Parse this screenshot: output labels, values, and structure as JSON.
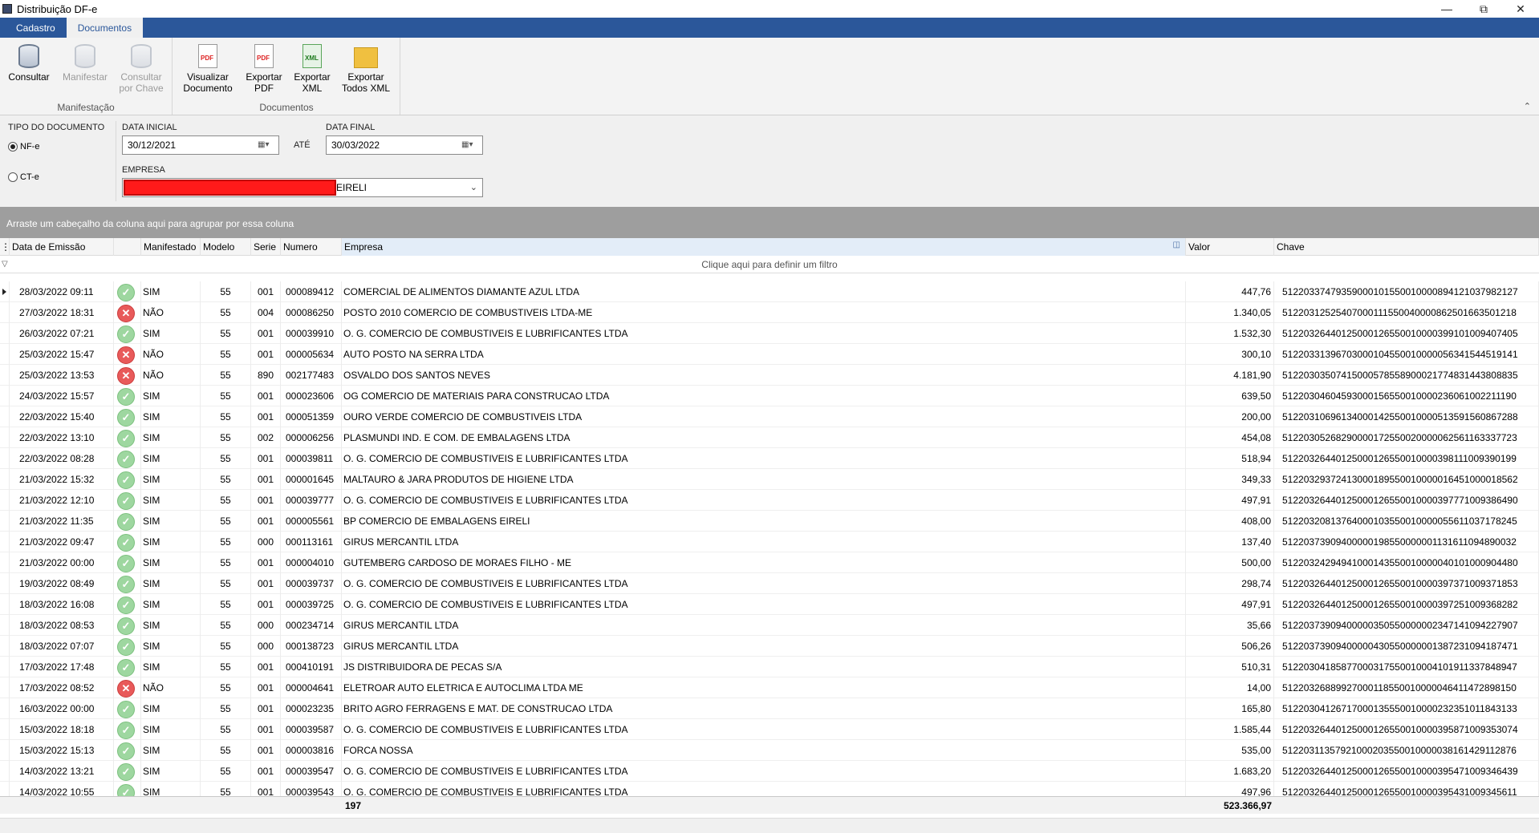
{
  "window": {
    "title": "Distribuição DF-e"
  },
  "tabs": [
    "Cadastro",
    "Documentos"
  ],
  "ribbon": {
    "groups": {
      "manifestacao": "Manifestação",
      "documentos": "Documentos"
    },
    "buttons": {
      "consultar": "Consultar",
      "manifestar": "Manifestar",
      "consultar_chave_1": "Consultar",
      "consultar_chave_2": "por Chave",
      "visualizar_1": "Visualizar",
      "visualizar_2": "Documento",
      "exp_pdf_1": "Exportar",
      "exp_pdf_2": "PDF",
      "exp_xml_1": "Exportar",
      "exp_xml_2": "XML",
      "exp_todos_1": "Exportar",
      "exp_todos_2": "Todos XML"
    }
  },
  "filters": {
    "tipo_label": "TIPO DO DOCUMENTO",
    "nfe": "NF-e",
    "cte": "CT-e",
    "data_inicial_label": "DATA INICIAL",
    "data_inicial": "30/12/2021",
    "ate": "ATÉ",
    "data_final_label": "DATA FINAL",
    "data_final": "30/03/2022",
    "empresa_label": "EMPRESA",
    "empresa_suffix": "EIRELI"
  },
  "grid": {
    "group_hint": "Arraste um cabeçalho da coluna aqui para agrupar por essa coluna",
    "filter_hint": "Clique aqui para definir um filtro",
    "columns": {
      "data": "Data de Emissão",
      "manifestado": "Manifestado",
      "modelo": "Modelo",
      "serie": "Serie",
      "numero": "Numero",
      "empresa": "Empresa",
      "valor": "Valor",
      "chave": "Chave"
    },
    "rows": [
      {
        "data": "28/03/2022 09:11",
        "ok": true,
        "man": "SIM",
        "mod": "55",
        "ser": "001",
        "num": "000089412",
        "emp": "COMERCIAL DE ALIMENTOS DIAMANTE AZUL LTDA",
        "val": "447,76",
        "chave": "51220337479359000101550010000894121037982127"
      },
      {
        "data": "27/03/2022 18:31",
        "ok": false,
        "man": "NÃO",
        "mod": "55",
        "ser": "004",
        "num": "000086250",
        "emp": "POSTO 2010 COMERCIO DE COMBUSTIVEIS LTDA-ME",
        "val": "1.340,05",
        "chave": "51220312525407000111550040000862501663501218"
      },
      {
        "data": "26/03/2022 07:21",
        "ok": true,
        "man": "SIM",
        "mod": "55",
        "ser": "001",
        "num": "000039910",
        "emp": "O. G. COMERCIO DE COMBUSTIVEIS E LUBRIFICANTES LTDA",
        "val": "1.532,30",
        "chave": "51220326440125000126550010000399101009407405"
      },
      {
        "data": "25/03/2022 15:47",
        "ok": false,
        "man": "NÃO",
        "mod": "55",
        "ser": "001",
        "num": "000005634",
        "emp": "AUTO POSTO NA SERRA LTDA",
        "val": "300,10",
        "chave": "51220331396703000104550010000056341544519141"
      },
      {
        "data": "25/03/2022 13:53",
        "ok": false,
        "man": "NÃO",
        "mod": "55",
        "ser": "890",
        "num": "002177483",
        "emp": "OSVALDO DOS SANTOS NEVES",
        "val": "4.181,90",
        "chave": "51220303507415000578558900021774831443808835"
      },
      {
        "data": "24/03/2022 15:57",
        "ok": true,
        "man": "SIM",
        "mod": "55",
        "ser": "001",
        "num": "000023606",
        "emp": "OG COMERCIO DE MATERIAIS PARA CONSTRUCAO LTDA",
        "val": "639,50",
        "chave": "51220304604593000156550010000236061002211190"
      },
      {
        "data": "22/03/2022 15:40",
        "ok": true,
        "man": "SIM",
        "mod": "55",
        "ser": "001",
        "num": "000051359",
        "emp": "OURO VERDE COMERCIO DE COMBUSTIVEIS LTDA",
        "val": "200,00",
        "chave": "51220310696134000142550010000513591560867288"
      },
      {
        "data": "22/03/2022 13:10",
        "ok": true,
        "man": "SIM",
        "mod": "55",
        "ser": "002",
        "num": "000006256",
        "emp": "PLASMUNDI IND. E COM. DE EMBALAGENS LTDA",
        "val": "454,08",
        "chave": "51220305268290000172550020000062561163337723"
      },
      {
        "data": "22/03/2022 08:28",
        "ok": true,
        "man": "SIM",
        "mod": "55",
        "ser": "001",
        "num": "000039811",
        "emp": "O. G. COMERCIO DE COMBUSTIVEIS E LUBRIFICANTES LTDA",
        "val": "518,94",
        "chave": "51220326440125000126550010000398111009390199"
      },
      {
        "data": "21/03/2022 15:32",
        "ok": true,
        "man": "SIM",
        "mod": "55",
        "ser": "001",
        "num": "000001645",
        "emp": "MALTAURO & JARA PRODUTOS DE HIGIENE LTDA",
        "val": "349,33",
        "chave": "51220329372413000189550010000016451000018562"
      },
      {
        "data": "21/03/2022 12:10",
        "ok": true,
        "man": "SIM",
        "mod": "55",
        "ser": "001",
        "num": "000039777",
        "emp": "O. G. COMERCIO DE COMBUSTIVEIS E LUBRIFICANTES LTDA",
        "val": "497,91",
        "chave": "51220326440125000126550010000397771009386490"
      },
      {
        "data": "21/03/2022 11:35",
        "ok": true,
        "man": "SIM",
        "mod": "55",
        "ser": "001",
        "num": "000005561",
        "emp": "BP COMERCIO DE EMBALAGENS EIRELI",
        "val": "408,00",
        "chave": "51220320813764000103550010000055611037178245"
      },
      {
        "data": "21/03/2022 09:47",
        "ok": true,
        "man": "SIM",
        "mod": "55",
        "ser": "000",
        "num": "000113161",
        "emp": "GIRUS MERCANTIL LTDA",
        "val": "137,40",
        "chave": "51220373909400000198550000001131611094890032"
      },
      {
        "data": "21/03/2022 00:00",
        "ok": true,
        "man": "SIM",
        "mod": "55",
        "ser": "001",
        "num": "000004010",
        "emp": "GUTEMBERG CARDOSO DE MORAES FILHO - ME",
        "val": "500,00",
        "chave": "51220324294941000143550010000040101000904480"
      },
      {
        "data": "19/03/2022 08:49",
        "ok": true,
        "man": "SIM",
        "mod": "55",
        "ser": "001",
        "num": "000039737",
        "emp": "O. G. COMERCIO DE COMBUSTIVEIS E LUBRIFICANTES LTDA",
        "val": "298,74",
        "chave": "51220326440125000126550010000397371009371853"
      },
      {
        "data": "18/03/2022 16:08",
        "ok": true,
        "man": "SIM",
        "mod": "55",
        "ser": "001",
        "num": "000039725",
        "emp": "O. G. COMERCIO DE COMBUSTIVEIS E LUBRIFICANTES LTDA",
        "val": "497,91",
        "chave": "51220326440125000126550010000397251009368282"
      },
      {
        "data": "18/03/2022 08:53",
        "ok": true,
        "man": "SIM",
        "mod": "55",
        "ser": "000",
        "num": "000234714",
        "emp": "GIRUS MERCANTIL LTDA",
        "val": "35,66",
        "chave": "51220373909400000350550000002347141094227907"
      },
      {
        "data": "18/03/2022 07:07",
        "ok": true,
        "man": "SIM",
        "mod": "55",
        "ser": "000",
        "num": "000138723",
        "emp": "GIRUS MERCANTIL LTDA",
        "val": "506,26",
        "chave": "51220373909400000430550000001387231094187471"
      },
      {
        "data": "17/03/2022 17:48",
        "ok": true,
        "man": "SIM",
        "mod": "55",
        "ser": "001",
        "num": "000410191",
        "emp": "JS DISTRIBUIDORA DE PECAS S/A",
        "val": "510,31",
        "chave": "51220304185877000317550010004101911337848947"
      },
      {
        "data": "17/03/2022 08:52",
        "ok": false,
        "man": "NÃO",
        "mod": "55",
        "ser": "001",
        "num": "000004641",
        "emp": "ELETROAR AUTO ELETRICA E AUTOCLIMA LTDA ME",
        "val": "14,00",
        "chave": "51220326889927000118550010000046411472898150"
      },
      {
        "data": "16/03/2022 00:00",
        "ok": true,
        "man": "SIM",
        "mod": "55",
        "ser": "001",
        "num": "000023235",
        "emp": "BRITO AGRO FERRAGENS E MAT. DE CONSTRUCAO LTDA",
        "val": "165,80",
        "chave": "51220304126717000135550010000232351011843133"
      },
      {
        "data": "15/03/2022 18:18",
        "ok": true,
        "man": "SIM",
        "mod": "55",
        "ser": "001",
        "num": "000039587",
        "emp": "O. G. COMERCIO DE COMBUSTIVEIS E LUBRIFICANTES LTDA",
        "val": "1.585,44",
        "chave": "51220326440125000126550010000395871009353074"
      },
      {
        "data": "15/03/2022 15:13",
        "ok": true,
        "man": "SIM",
        "mod": "55",
        "ser": "001",
        "num": "000003816",
        "emp": "FORCA NOSSA",
        "val": "535,00",
        "chave": "51220311357921000203550010000038161429112876"
      },
      {
        "data": "14/03/2022 13:21",
        "ok": true,
        "man": "SIM",
        "mod": "55",
        "ser": "001",
        "num": "000039547",
        "emp": "O. G. COMERCIO DE COMBUSTIVEIS E LUBRIFICANTES LTDA",
        "val": "1.683,20",
        "chave": "51220326440125000126550010000395471009346439"
      },
      {
        "data": "14/03/2022 10:55",
        "ok": true,
        "man": "SIM",
        "mod": "55",
        "ser": "001",
        "num": "000039543",
        "emp": "O. G. COMERCIO DE COMBUSTIVEIS E LUBRIFICANTES LTDA",
        "val": "497,96",
        "chave": "51220326440125000126550010000395431009345611"
      }
    ],
    "footer": {
      "count": "197",
      "total": "523.366,97"
    }
  }
}
